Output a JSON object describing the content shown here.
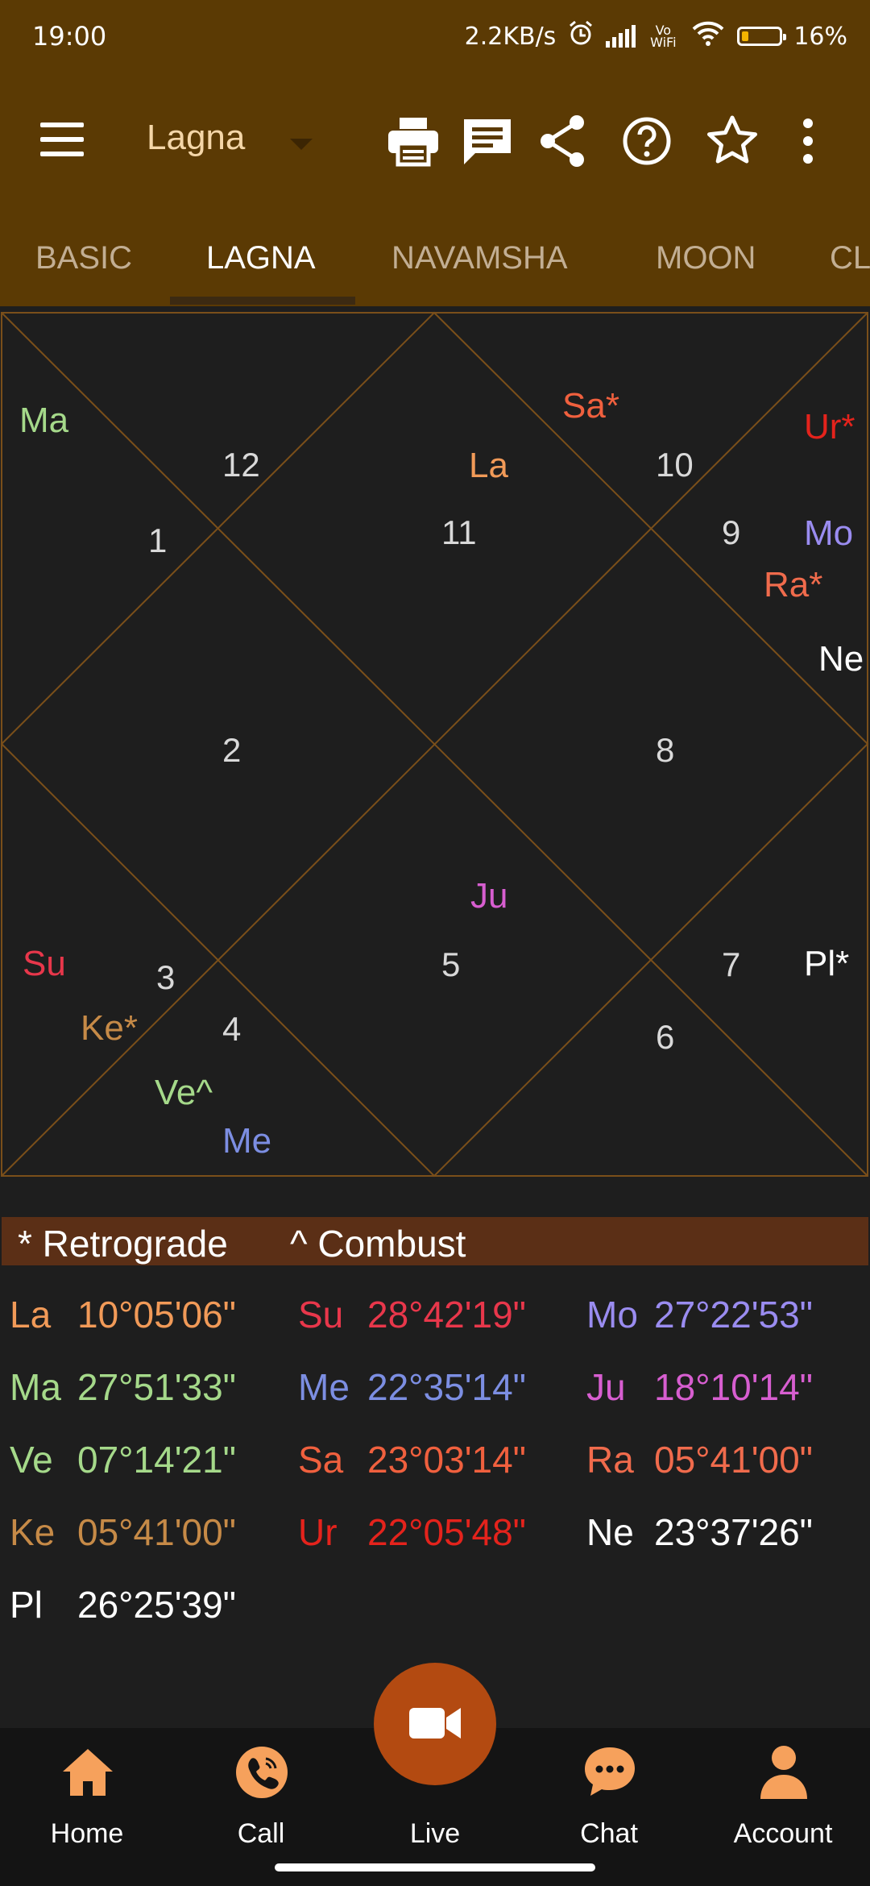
{
  "status_bar": {
    "time": "19:00",
    "net_speed": "2.2KB/s",
    "volte": "Vo WiFi",
    "battery_percent": "16%",
    "battery_level": 0.16
  },
  "app_bar": {
    "title": "Lagna"
  },
  "tabs": [
    {
      "label": "BASIC",
      "active": false
    },
    {
      "label": "LAGNA",
      "active": true
    },
    {
      "label": "NAVAMSHA",
      "active": false
    },
    {
      "label": "MOON",
      "active": false
    },
    {
      "label": "CL",
      "active": false
    }
  ],
  "chart": {
    "planets": [
      {
        "label": "Ma",
        "color": "#a5d98a"
      },
      {
        "label": "Sa*",
        "color": "#f0603e"
      },
      {
        "label": "La",
        "color": "#f19a58"
      },
      {
        "label": "Ur*",
        "color": "#e4231c"
      },
      {
        "label": "Mo",
        "color": "#9a8cf0"
      },
      {
        "label": "Ra*",
        "color": "#f06b4c"
      },
      {
        "label": "Ne",
        "color": "#ffffff"
      },
      {
        "label": "Ju",
        "color": "#d75ed0"
      },
      {
        "label": "Su",
        "color": "#e8374b"
      },
      {
        "label": "Ke*",
        "color": "#c68a47"
      },
      {
        "label": "Ve^",
        "color": "#a5d98a"
      },
      {
        "label": "Me",
        "color": "#7c8ee2"
      },
      {
        "label": "Pl*",
        "color": "#ffffff"
      }
    ],
    "houses": [
      "12",
      "11",
      "10",
      "9",
      "1",
      "2",
      "8",
      "3",
      "4",
      "5",
      "7",
      "6"
    ]
  },
  "legend": {
    "retrograde": "* Retrograde",
    "combust": "^ Combust"
  },
  "degrees": [
    {
      "abbr": "La",
      "value": "10°05'06\"",
      "color": "#f19a58"
    },
    {
      "abbr": "Su",
      "value": "28°42'19\"",
      "color": "#e8374b"
    },
    {
      "abbr": "Mo",
      "value": "27°22'53\"",
      "color": "#9a8cf0"
    },
    {
      "abbr": "Ma",
      "value": "27°51'33\"",
      "color": "#a5d98a"
    },
    {
      "abbr": "Me",
      "value": "22°35'14\"",
      "color": "#7c8ee2"
    },
    {
      "abbr": "Ju",
      "value": "18°10'14\"",
      "color": "#d75ed0"
    },
    {
      "abbr": "Ve",
      "value": "07°14'21\"",
      "color": "#a5d98a"
    },
    {
      "abbr": "Sa",
      "value": "23°03'14\"",
      "color": "#f0603e"
    },
    {
      "abbr": "Ra",
      "value": "05°41'00\"",
      "color": "#f06b4c"
    },
    {
      "abbr": "Ke",
      "value": "05°41'00\"",
      "color": "#c68a47"
    },
    {
      "abbr": "Ur",
      "value": "22°05'48\"",
      "color": "#e4231c"
    },
    {
      "abbr": "Ne",
      "value": "23°37'26\"",
      "color": "#ffffff"
    },
    {
      "abbr": "Pl",
      "value": "26°25'39\"",
      "color": "#ffffff"
    }
  ],
  "bottom_nav": {
    "items": [
      {
        "label": "Home",
        "icon": "home-icon"
      },
      {
        "label": "Call",
        "icon": "phone-icon"
      },
      {
        "label": "Live",
        "icon": "video-camera-icon"
      },
      {
        "label": "Chat",
        "icon": "chat-bubble-icon"
      },
      {
        "label": "Account",
        "icon": "person-icon"
      }
    ]
  },
  "colors": {
    "app_bar": "#5b3a04",
    "chart_lines": "#8a5a1e",
    "legend_bar": "#5b2f16",
    "accent_orange": "#f6a15c",
    "fab": "#b34a11"
  }
}
